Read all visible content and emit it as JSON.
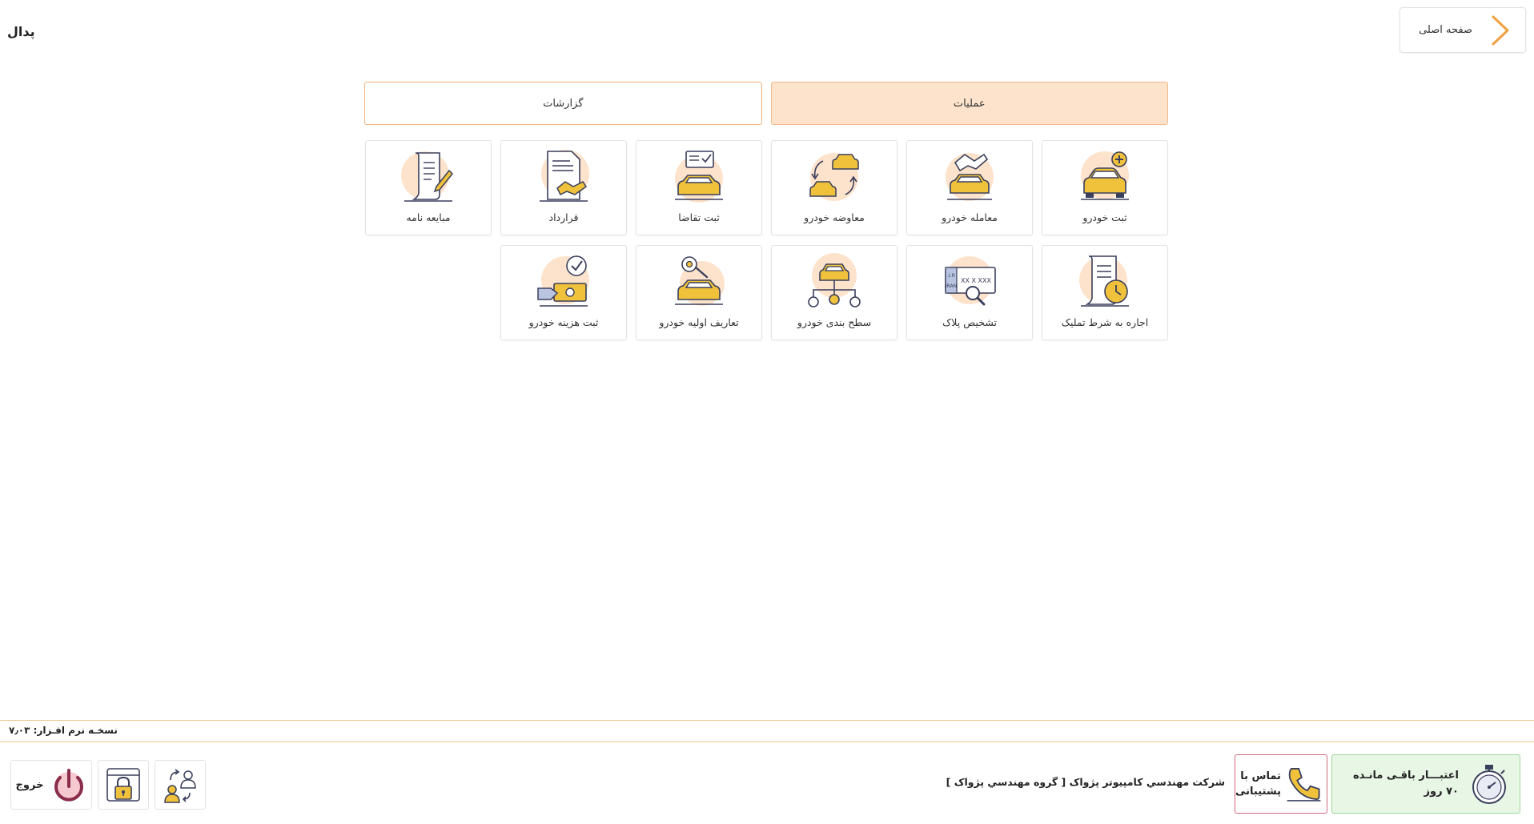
{
  "header": {
    "home_label": "صفحه اصلی",
    "app_title": "پدال"
  },
  "tabs": [
    {
      "label": "عملیات",
      "active": true
    },
    {
      "label": "گزارشات",
      "active": false
    }
  ],
  "tiles": [
    {
      "label": "ثبت خودرو",
      "icon": "car-add-icon"
    },
    {
      "label": "معامله خودرو",
      "icon": "car-deal-icon"
    },
    {
      "label": "معاوضه خودرو",
      "icon": "car-exchange-icon"
    },
    {
      "label": "ثبت تقاضا",
      "icon": "car-request-icon"
    },
    {
      "label": "قرارداد",
      "icon": "contract-icon"
    },
    {
      "label": "مبایعه نامه",
      "icon": "deed-icon"
    },
    {
      "label": "اجاره به شرط تملیک",
      "icon": "lease-icon"
    },
    {
      "label": "تشخیص پلاک",
      "icon": "plate-detect-icon"
    },
    {
      "label": "سطح بندی خودرو",
      "icon": "car-levels-icon"
    },
    {
      "label": "تعاریف اولیه خودرو",
      "icon": "car-settings-icon"
    },
    {
      "label": "ثبت هزینه خودرو",
      "icon": "car-cost-icon"
    }
  ],
  "plate_text": {
    "country": "I.R.",
    "name": "IRAN",
    "number": "XX X XXX"
  },
  "footer": {
    "version": "نسخـه نرم افـزار: ۷٫۰۳",
    "credit_line1": "اعتبـــار باقـی مانـده",
    "credit_line2": "۷۰ روز",
    "support_line1": "تماس با",
    "support_line2": "پشتیبانی",
    "company": "شرکت مهندسي کامپيوتر پژواک [ گروه مهندسي پژواک ]",
    "exit_label": "خروج"
  },
  "colors": {
    "accent": "#f0a040",
    "tab_active_bg": "#fde3cc",
    "car_yellow": "#f0c23c",
    "icon_circle": "#fde3cc",
    "outline": "#3a3f5c",
    "credit_bg": "#e8f6e6",
    "support_border": "#d06b7a"
  }
}
